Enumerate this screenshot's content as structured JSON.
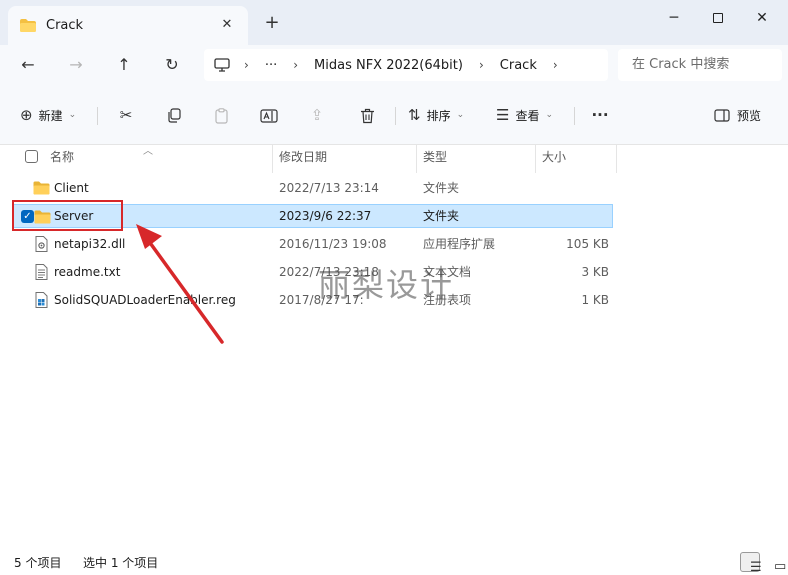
{
  "window": {
    "tab_title": "Crack",
    "tab_close": "✕",
    "new_tab": "+",
    "minimize": "─",
    "close": "✕"
  },
  "nav": {
    "back": "←",
    "forward": "→",
    "up": "↑",
    "refresh": "↻"
  },
  "address": {
    "ellipsis": "···",
    "crumbs": [
      "Midas NFX 2022(64bit)",
      "Crack"
    ],
    "sep": "›"
  },
  "search": {
    "placeholder": "在 Crack 中搜索"
  },
  "toolbar": {
    "new_label": "新建",
    "sort_label": "排序",
    "view_label": "查看",
    "more": "···",
    "preview_label": "预览"
  },
  "columns": {
    "name": "名称",
    "date": "修改日期",
    "type": "类型",
    "size": "大小"
  },
  "files": [
    {
      "name": "Client",
      "date": "2022/7/13 23:14",
      "type": "文件夹",
      "size": "",
      "icon": "folder-icon",
      "selected": false
    },
    {
      "name": "Server",
      "date": "2023/9/6 22:37",
      "type": "文件夹",
      "size": "",
      "icon": "folder-icon",
      "selected": true
    },
    {
      "name": "netapi32.dll",
      "date": "2016/11/23 19:08",
      "type": "应用程序扩展",
      "size": "105 KB",
      "icon": "dll-file-icon",
      "selected": false
    },
    {
      "name": "readme.txt",
      "date": "2022/7/13 23:18",
      "type": "文本文档",
      "size": "3 KB",
      "icon": "text-file-icon",
      "selected": false
    },
    {
      "name": "SolidSQUADLoaderEnabler.reg",
      "date": "2017/8/27 17:",
      "type": "注册表项",
      "size": "1 KB",
      "icon": "registry-file-icon",
      "selected": false
    }
  ],
  "status": {
    "count": "5 个项目",
    "selected": "选中 1 个项目"
  },
  "watermark": "丽梨设计",
  "colors": {
    "accent": "#0067c0",
    "selection": "#cce8ff",
    "highlight_red": "#d7282a"
  }
}
